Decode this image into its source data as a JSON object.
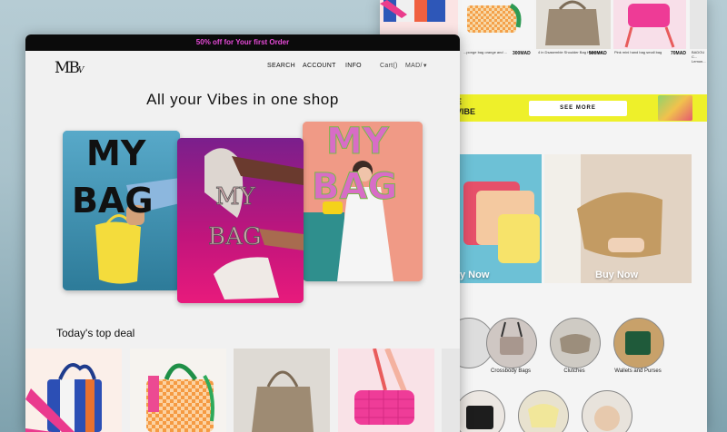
{
  "back_page": {
    "products": [
      {
        "caption": "...ponge bag orange and ...",
        "price": "300MAD"
      },
      {
        "caption": "4 in Dsasemble Shoulder Bag Hazelnut",
        "price": "500MAD"
      },
      {
        "caption": "Pink mini hand bag small bag",
        "price": "70MAD"
      },
      {
        "caption": "BADOU C... Lemon..."
      }
    ],
    "banner": {
      "text_line1": "E",
      "text_line2": "VIBE",
      "cta": "SEE MORE"
    },
    "promos": [
      {
        "label": "y Now"
      },
      {
        "label": "Buy Now"
      }
    ],
    "categories": [
      {
        "label": "Crossbody Bags"
      },
      {
        "label": "Clutches"
      },
      {
        "label": "Wallets and Purses"
      }
    ]
  },
  "front_page": {
    "announcement": "50% off for Your first  Order",
    "logo": "MB",
    "logo_sub": "V",
    "nav": {
      "search": "SEARCH",
      "account": "ACCOUNT",
      "info": "INFO",
      "cart": "Cart()",
      "currency": "MAD/"
    },
    "headline": "All your Vibes in one shop",
    "hero_cards": [
      {
        "word1": "MY",
        "word2": "BAG"
      },
      {
        "word1": "MY",
        "word2": "BAG"
      },
      {
        "word1": "MY",
        "word2": "BAG"
      }
    ],
    "section_title": "Today's top deal"
  },
  "colors": {
    "accent_pink": "#e74ad8",
    "banner_yellow": "#eef02a",
    "topbar": "#0b0b0b"
  }
}
